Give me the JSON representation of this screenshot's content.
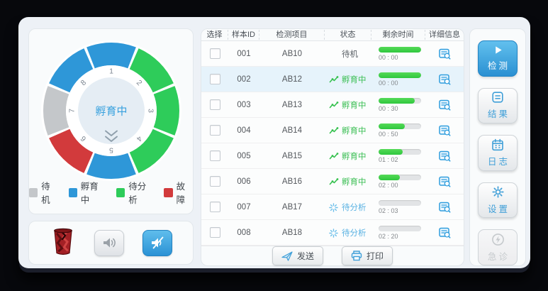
{
  "wheel": {
    "center_label": "孵育中",
    "slot_numbers": [
      "1",
      "2",
      "3",
      "4",
      "5",
      "6",
      "7",
      "8"
    ],
    "slot_statuses": [
      "incubating",
      "to_analyze",
      "to_analyze",
      "to_analyze",
      "incubating",
      "fault",
      "standby",
      "incubating"
    ],
    "status_colors": {
      "standby": "#c4c7ca",
      "incubating": "#2e97d8",
      "to_analyze": "#2ecc5a",
      "fault": "#d23a3c"
    }
  },
  "legend": {
    "items": [
      {
        "label": "待机",
        "status": "standby"
      },
      {
        "label": "孵育中",
        "status": "incubating"
      },
      {
        "label": "待分析",
        "status": "to_analyze"
      },
      {
        "label": "故障",
        "status": "fault"
      }
    ]
  },
  "table": {
    "columns": [
      "选择",
      "样本ID",
      "检测项目",
      "状态",
      "剩余时间",
      "详细信息"
    ],
    "rows": [
      {
        "sample_id": "001",
        "item": "AB10",
        "status_label": "待机",
        "status_type": "standby",
        "remaining": "00 : 00",
        "progress_pct": 100,
        "highlighted": false
      },
      {
        "sample_id": "002",
        "item": "AB12",
        "status_label": "孵育中",
        "status_type": "incubating",
        "remaining": "00 : 00",
        "progress_pct": 100,
        "highlighted": true
      },
      {
        "sample_id": "003",
        "item": "AB13",
        "status_label": "孵育中",
        "status_type": "incubating",
        "remaining": "00 : 30",
        "progress_pct": 85,
        "highlighted": false
      },
      {
        "sample_id": "004",
        "item": "AB14",
        "status_label": "孵育中",
        "status_type": "incubating",
        "remaining": "00 : 50",
        "progress_pct": 61,
        "highlighted": false
      },
      {
        "sample_id": "005",
        "item": "AB15",
        "status_label": "孵育中",
        "status_type": "incubating",
        "remaining": "01 : 02",
        "progress_pct": 57,
        "highlighted": false
      },
      {
        "sample_id": "006",
        "item": "AB16",
        "status_label": "孵育中",
        "status_type": "incubating",
        "remaining": "02 : 00",
        "progress_pct": 50,
        "highlighted": false
      },
      {
        "sample_id": "007",
        "item": "AB17",
        "status_label": "待分析",
        "status_type": "analyze",
        "remaining": "02 : 03",
        "progress_pct": 0,
        "highlighted": false
      },
      {
        "sample_id": "008",
        "item": "AB18",
        "status_label": "待分析",
        "status_type": "analyze",
        "remaining": "02 : 20",
        "progress_pct": 0,
        "highlighted": false
      }
    ],
    "send_label": "发送",
    "print_label": "打印"
  },
  "status_text_colors": {
    "standby": "#5a6066",
    "incubating": "#3cbf55",
    "analyze": "#58b1e2"
  },
  "actions": [
    {
      "key": "detect",
      "label": "检测",
      "icon": "play-icon",
      "state": "primary"
    },
    {
      "key": "results",
      "label": "结果",
      "icon": "result-icon",
      "state": "normal"
    },
    {
      "key": "log",
      "label": "日志",
      "icon": "log-icon",
      "state": "normal"
    },
    {
      "key": "settings",
      "label": "设置",
      "icon": "settings-icon",
      "state": "normal"
    },
    {
      "key": "emergency",
      "label": "急诊",
      "icon": "emergency-icon",
      "state": "disabled"
    }
  ],
  "sound": {
    "sound_on_active": false,
    "mute_active": true
  }
}
